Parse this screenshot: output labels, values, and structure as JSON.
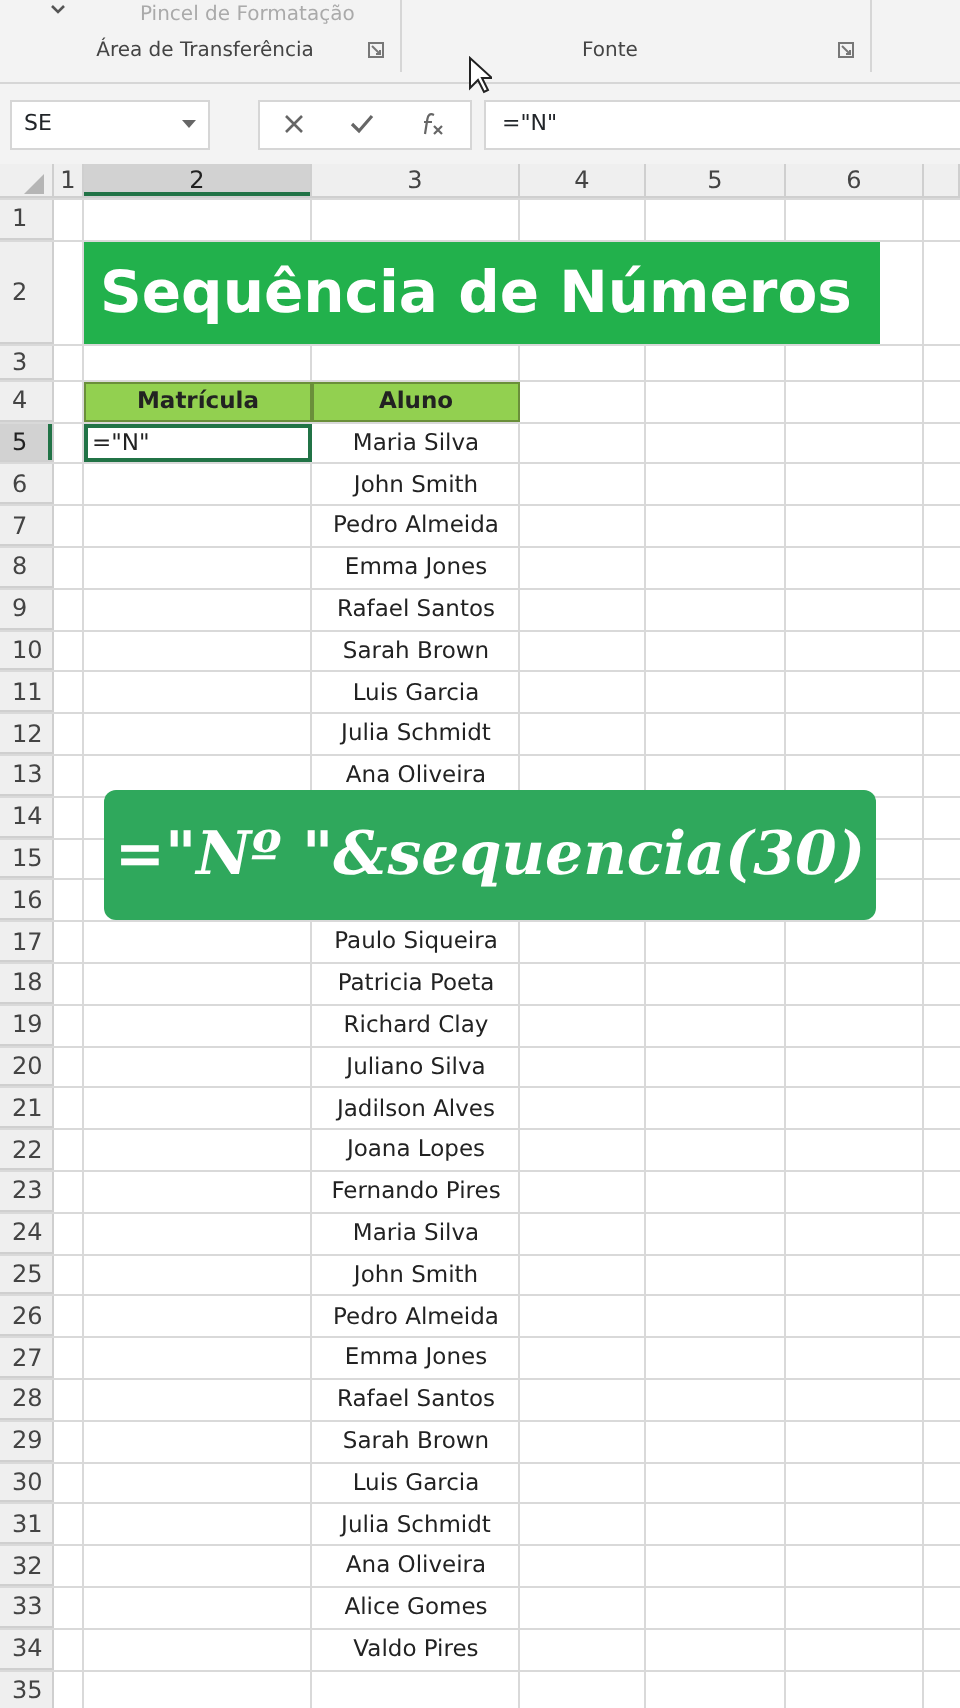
{
  "ribbon": {
    "top_items": [
      {
        "label": "Pincel de Formatação",
        "disabled": true
      }
    ],
    "groups": [
      {
        "label": "Área de Transferência"
      },
      {
        "label": "Fonte"
      }
    ]
  },
  "formula_bar": {
    "name_box": "SE",
    "formula": "=\"N\""
  },
  "columns": [
    {
      "label": "1",
      "selected": false
    },
    {
      "label": "2",
      "selected": true
    },
    {
      "label": "3",
      "selected": false
    },
    {
      "label": "4",
      "selected": false
    },
    {
      "label": "5",
      "selected": false
    },
    {
      "label": "6",
      "selected": false
    }
  ],
  "rows": [
    {
      "number": "1",
      "kind": "blank",
      "selected": false
    },
    {
      "number": "2",
      "kind": "title",
      "selected": false,
      "title": "Sequência de Números"
    },
    {
      "number": "3",
      "kind": "blank",
      "selected": false
    },
    {
      "number": "4",
      "kind": "header",
      "selected": false,
      "headers": [
        "Matrícula",
        "Aluno"
      ]
    },
    {
      "number": "5",
      "kind": "data",
      "selected": true,
      "matricula": "=\"N\"",
      "aluno": "Maria Silva"
    },
    {
      "number": "6",
      "kind": "data",
      "selected": false,
      "aluno": "John Smith"
    },
    {
      "number": "7",
      "kind": "data",
      "selected": false,
      "aluno": "Pedro Almeida"
    },
    {
      "number": "8",
      "kind": "data",
      "selected": false,
      "aluno": "Emma Jones"
    },
    {
      "number": "9",
      "kind": "data",
      "selected": false,
      "aluno": "Rafael Santos"
    },
    {
      "number": "10",
      "kind": "data",
      "selected": false,
      "aluno": "Sarah Brown"
    },
    {
      "number": "11",
      "kind": "data",
      "selected": false,
      "aluno": "Luis Garcia"
    },
    {
      "number": "12",
      "kind": "data",
      "selected": false,
      "aluno": "Julia Schmidt"
    },
    {
      "number": "13",
      "kind": "data",
      "selected": false,
      "aluno": "Ana Oliveira"
    },
    {
      "number": "14",
      "kind": "data",
      "selected": false
    },
    {
      "number": "15",
      "kind": "data",
      "selected": false
    },
    {
      "number": "16",
      "kind": "data",
      "selected": false
    },
    {
      "number": "17",
      "kind": "data",
      "selected": false,
      "aluno": "Paulo Siqueira"
    },
    {
      "number": "18",
      "kind": "data",
      "selected": false,
      "aluno": "Patricia Poeta"
    },
    {
      "number": "19",
      "kind": "data",
      "selected": false,
      "aluno": "Richard Clay"
    },
    {
      "number": "20",
      "kind": "data",
      "selected": false,
      "aluno": "Juliano Silva"
    },
    {
      "number": "21",
      "kind": "data",
      "selected": false,
      "aluno": "Jadilson Alves"
    },
    {
      "number": "22",
      "kind": "data",
      "selected": false,
      "aluno": "Joana Lopes"
    },
    {
      "number": "23",
      "kind": "data",
      "selected": false,
      "aluno": "Fernando Pires"
    },
    {
      "number": "24",
      "kind": "data",
      "selected": false,
      "aluno": "Maria Silva"
    },
    {
      "number": "25",
      "kind": "data",
      "selected": false,
      "aluno": "John Smith"
    },
    {
      "number": "26",
      "kind": "data",
      "selected": false,
      "aluno": "Pedro Almeida"
    },
    {
      "number": "27",
      "kind": "data",
      "selected": false,
      "aluno": "Emma Jones"
    },
    {
      "number": "28",
      "kind": "data",
      "selected": false,
      "aluno": "Rafael Santos"
    },
    {
      "number": "29",
      "kind": "data",
      "selected": false,
      "aluno": "Sarah Brown"
    },
    {
      "number": "30",
      "kind": "data",
      "selected": false,
      "aluno": "Luis Garcia"
    },
    {
      "number": "31",
      "kind": "data",
      "selected": false,
      "aluno": "Julia Schmidt"
    },
    {
      "number": "32",
      "kind": "data",
      "selected": false,
      "aluno": "Ana Oliveira"
    },
    {
      "number": "33",
      "kind": "data",
      "selected": false,
      "aluno": "Alice Gomes"
    },
    {
      "number": "34",
      "kind": "data",
      "selected": false,
      "aluno": "Valdo Pires"
    },
    {
      "number": "35",
      "kind": "blank",
      "selected": false
    }
  ],
  "caption": {
    "text": "=\"Nº \"&sequencia(30)"
  }
}
